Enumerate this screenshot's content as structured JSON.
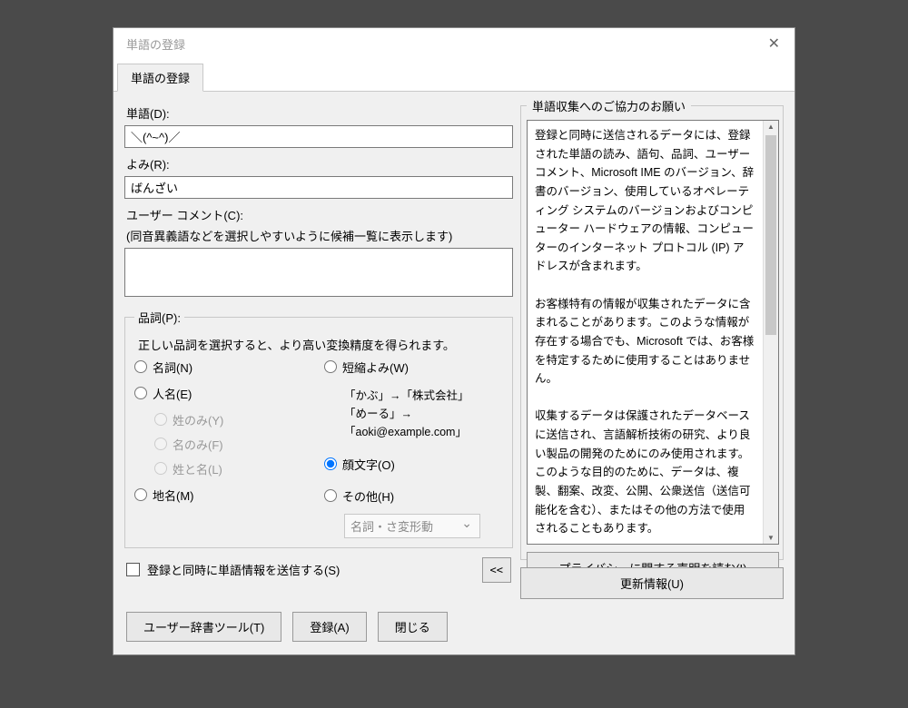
{
  "window": {
    "title": "単語の登録"
  },
  "tab": {
    "label": "単語の登録"
  },
  "fields": {
    "word_label": "単語(D):",
    "word_value": "＼(^~^)／",
    "reading_label": "よみ(R):",
    "reading_value": "ばんざい",
    "comment_label": "ユーザー コメント(C):",
    "comment_hint": "(同音異義語などを選択しやすいように候補一覧に表示します)",
    "comment_value": ""
  },
  "pos": {
    "legend": "品詞(P):",
    "desc": "正しい品詞を選択すると、より高い変換精度を得られます。",
    "noun": "名詞(N)",
    "person": "人名(E)",
    "person_last": "姓のみ(Y)",
    "person_first": "名のみ(F)",
    "person_both": "姓と名(L)",
    "place": "地名(M)",
    "short": "短縮よみ(W)",
    "example1": "「かぶ」→「株式会社」",
    "example2": "「めーる」→「aoki@example.com」",
    "kaomoji": "顔文字(O)",
    "other": "その他(H)",
    "other_select": "名詞・さ変形動",
    "selected": "kaomoji"
  },
  "send_checkbox": "登録と同時に単語情報を送信する(S)",
  "collapse_btn": "<<",
  "help": {
    "legend": "単語収集へのご協力のお願い",
    "body": "登録と同時に送信されるデータには、登録された単語の読み、語句、品詞、ユーザーコメント、Microsoft IME のバージョン、辞書のバージョン、使用しているオペレーティング システムのバージョンおよびコンピューター ハードウェアの情報、コンピューターのインターネット プロトコル (IP) アドレスが含まれます。\n\nお客様特有の情報が収集されたデータに含まれることがあります。このような情報が存在する場合でも、Microsoft では、お客様を特定するために使用することはありません。\n\n収集するデータは保護されたデータベースに送信され、言語解析技術の研究、より良い製品の開発のためにのみ使用されます。このような目的のために、データは、複製、翻案、改変、公開、公衆送信（送信可能化を含む）、またはその他の方法で使用されることもあります。"
  },
  "privacy_btn": "プライバシーに関する声明を読む(I)",
  "update_btn": "更新情報(U)",
  "footer": {
    "tool": "ユーザー辞書ツール(T)",
    "register": "登録(A)",
    "close": "閉じる"
  }
}
